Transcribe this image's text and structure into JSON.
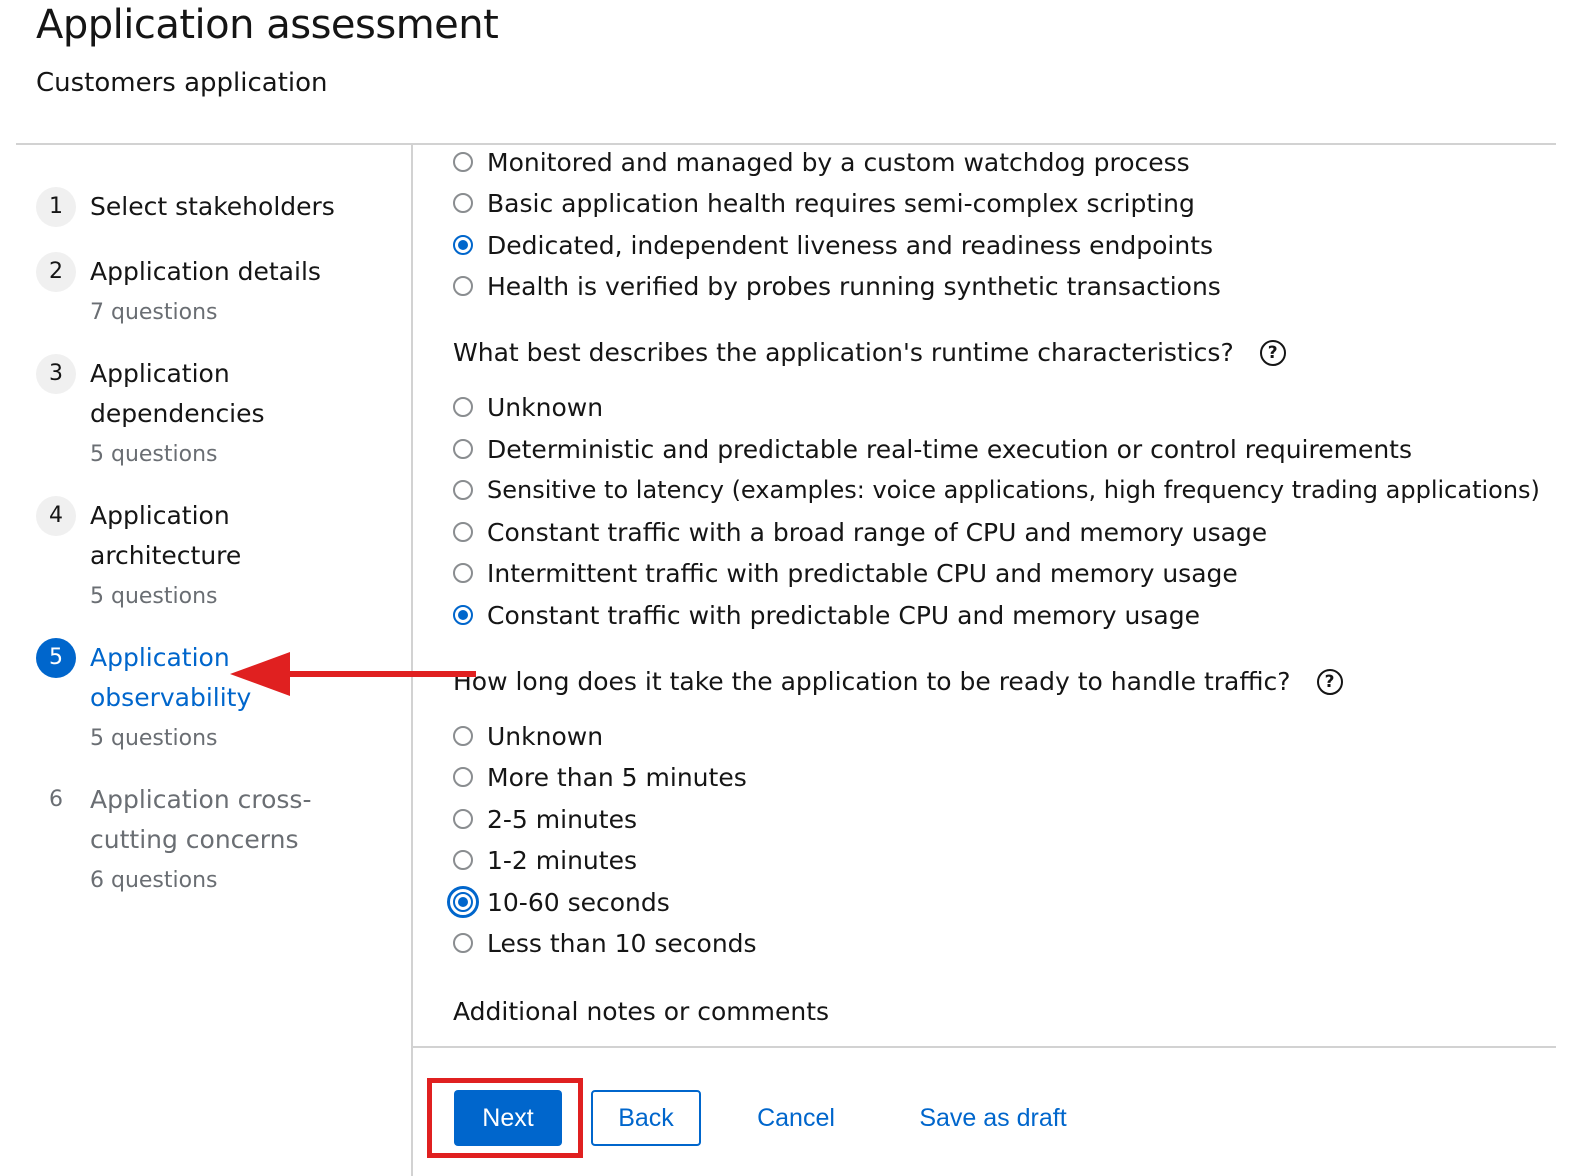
{
  "header": {
    "title": "Application assessment",
    "subtitle": "Customers application"
  },
  "wizard_nav": {
    "steps": [
      {
        "number": "1",
        "label": "Select stakeholders",
        "sub": ""
      },
      {
        "number": "2",
        "label": "Application details",
        "sub": "7 questions"
      },
      {
        "number": "3",
        "label": "Application dependencies",
        "sub": "5 questions"
      },
      {
        "number": "4",
        "label": "Application architecture",
        "sub": "5 questions"
      },
      {
        "number": "5",
        "label": "Application observability",
        "sub": "5 questions",
        "current": true
      },
      {
        "number": "6",
        "label": "Application cross-cutting concerns",
        "sub": "6 questions"
      }
    ]
  },
  "content": {
    "health_options": [
      {
        "label": "Monitored and managed by a custom watchdog process",
        "checked": false
      },
      {
        "label": "Basic application health requires semi-complex scripting",
        "checked": false
      },
      {
        "label": "Dedicated, independent liveness and readiness endpoints",
        "checked": true
      },
      {
        "label": "Health is verified by probes running synthetic transactions",
        "checked": false
      }
    ],
    "q_runtime": {
      "text": "What best describes the application's runtime characteristics?",
      "options": [
        {
          "label": "Unknown",
          "checked": false
        },
        {
          "label": "Deterministic and predictable real-time execution or control requirements",
          "checked": false
        },
        {
          "label": "Sensitive to latency (examples: voice applications, high frequency trading applications)",
          "checked": false
        },
        {
          "label": "Constant traffic with a broad range of CPU and memory usage",
          "checked": false
        },
        {
          "label": "Intermittent traffic with predictable CPU and memory usage",
          "checked": false
        },
        {
          "label": "Constant traffic with predictable CPU and memory usage",
          "checked": true
        }
      ]
    },
    "q_ready": {
      "text": "How long does it take the application to be ready to handle traffic?",
      "options": [
        {
          "label": "Unknown",
          "checked": false
        },
        {
          "label": "More than 5 minutes",
          "checked": false
        },
        {
          "label": "2-5 minutes",
          "checked": false
        },
        {
          "label": "1-2 minutes",
          "checked": false
        },
        {
          "label": "10-60 seconds",
          "checked": true
        },
        {
          "label": "Less than 10 seconds",
          "checked": false
        }
      ]
    },
    "notes_label": "Additional notes or comments",
    "help_icon_glyph": "?"
  },
  "footer": {
    "next_label": "Next",
    "back_label": "Back",
    "cancel_label": "Cancel",
    "draft_label": "Save as draft"
  },
  "colors": {
    "primary": "#0066cc",
    "annotation": "#e02020"
  }
}
